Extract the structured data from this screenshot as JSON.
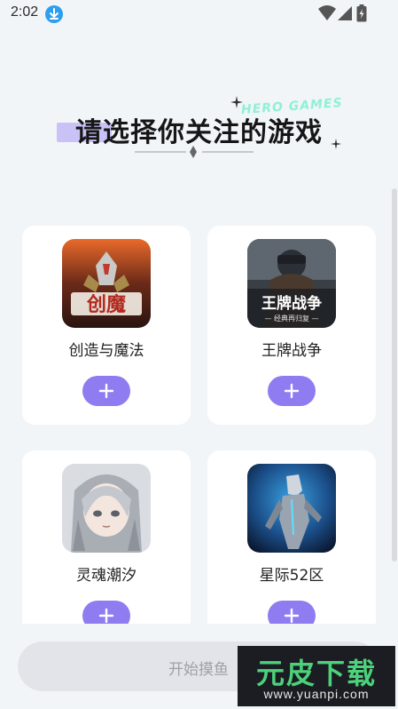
{
  "status_bar": {
    "time": "2:02",
    "icons": [
      "download-icon",
      "wifi-icon",
      "signal-icon",
      "battery-icon"
    ]
  },
  "header": {
    "title": "请选择你关注的游戏",
    "decoration_text": "HERO GAMES"
  },
  "games": [
    {
      "name": "创造与魔法",
      "cover_label": "创魔",
      "add_label": "+"
    },
    {
      "name": "王牌战争",
      "cover_label": "王牌战争",
      "cover_sublabel": "— 经典再归复 —",
      "add_label": "+"
    },
    {
      "name": "灵魂潮汐",
      "add_label": "+"
    },
    {
      "name": "星际52区",
      "add_label": "+"
    }
  ],
  "footer": {
    "start_button_label": "开始摸鱼"
  },
  "watermark": {
    "logo_text": "元皮下载",
    "url": "www.yuanpi.com"
  },
  "colors": {
    "background": "#f2f5f8",
    "accent": "#8f7cf0",
    "highlight": "#c9c2f7",
    "download_badge": "#2d9ef0"
  }
}
